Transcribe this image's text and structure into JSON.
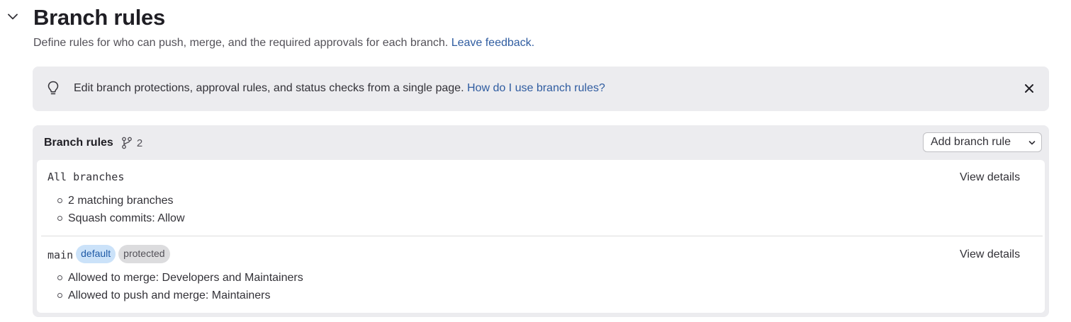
{
  "page": {
    "title": "Branch rules",
    "description": "Define rules for who can push, merge, and the required approvals for each branch.",
    "feedback_link": "Leave feedback."
  },
  "alert": {
    "message": "Edit branch protections, approval rules, and status checks from a single page.",
    "link": "How do I use branch rules?"
  },
  "card": {
    "title": "Branch rules",
    "count": "2",
    "add_button": "Add branch rule"
  },
  "rules": [
    {
      "name": "All branches",
      "view_link": "View details",
      "details": [
        "2 matching branches",
        "Squash commits: Allow"
      ]
    },
    {
      "name": "main",
      "badges": [
        "default",
        "protected"
      ],
      "view_link": "View details",
      "details": [
        "Allowed to merge: Developers and Maintainers",
        "Allowed to push and merge: Maintainers"
      ]
    }
  ],
  "icons": {
    "collapse": "chevron-down-icon",
    "alert": "lightbulb-icon",
    "close": "close-icon",
    "branch": "branch-icon",
    "dropdown": "chevron-down-icon"
  },
  "colors": {
    "link": "#2f5ca0",
    "panel_bg": "#ececef",
    "badge_default_bg": "#cbe2f9",
    "badge_protected_bg": "#dcdcde"
  }
}
